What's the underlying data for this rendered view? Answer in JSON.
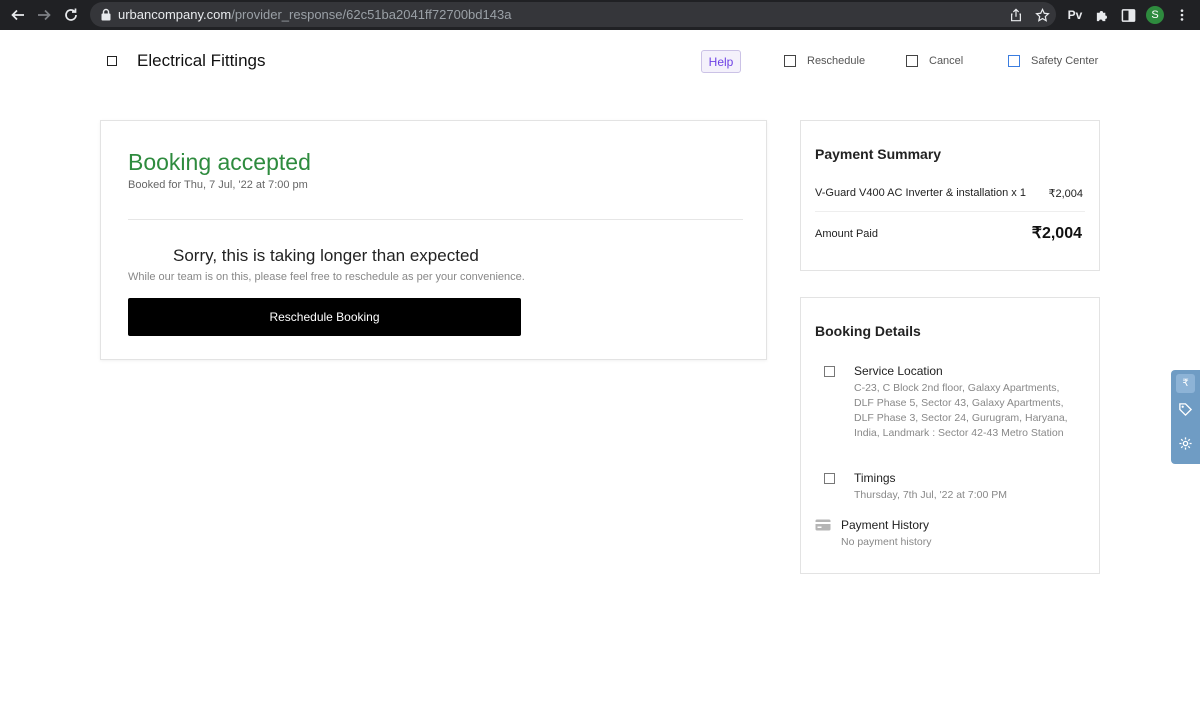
{
  "browser": {
    "url_host": "urbancompany.com",
    "url_path": "/provider_response/62c51ba2041ff72700bd143a",
    "extension_pv": "Pv",
    "avatar_initial": "S"
  },
  "header": {
    "title": "Electrical Fittings",
    "help_label": "Help",
    "actions": [
      {
        "label": "Reschedule"
      },
      {
        "label": "Cancel"
      },
      {
        "label": "Safety Center"
      }
    ]
  },
  "status": {
    "title": "Booking accepted",
    "booked_for": "Booked for Thu, 7 Jul, '22 at 7:00 pm",
    "sorry_title": "Sorry, this is taking longer than expected",
    "sorry_sub": "While our team is on this, please feel free to reschedule as per your convenience.",
    "button_label": "Reschedule Booking"
  },
  "payment": {
    "heading": "Payment Summary",
    "item_name": "V-Guard V400 AC Inverter & installation x 1",
    "item_price": "₹2,004",
    "amount_label": "Amount Paid",
    "amount_value": "₹2,004"
  },
  "details": {
    "heading": "Booking Details",
    "location_title": "Service Location",
    "location_text": "C-23, C Block 2nd floor, Galaxy Apartments, DLF Phase 5, Sector 43, Galaxy Apartments, DLF Phase 3, Sector 24, Gurugram, Haryana, India, Landmark : Sector 42-43 Metro Station",
    "timings_title": "Timings",
    "timings_text": "Thursday, 7th Jul, '22 at 7:00 PM",
    "history_title": "Payment History",
    "history_text": "No payment history"
  },
  "colors": {
    "accent_green": "#2e8b3e",
    "help_purple": "#6e42e5",
    "widget_blue": "#6f9cc4"
  }
}
